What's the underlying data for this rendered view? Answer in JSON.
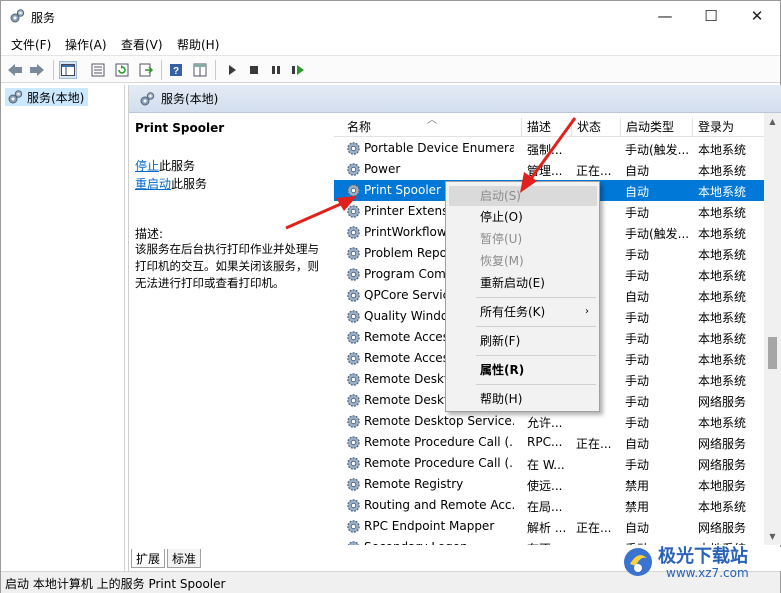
{
  "window": {
    "title": "服务",
    "minimize": "—",
    "maximize": "☐",
    "close": "✕"
  },
  "menu": [
    "文件(F)",
    "操作(A)",
    "查看(V)",
    "帮助(H)"
  ],
  "tree": {
    "root_label": "服务(本地)"
  },
  "main": {
    "header_title": "服务(本地)"
  },
  "desc_panel": {
    "service_name": "Print Spooler",
    "stop_link": "停止",
    "stop_suffix": "此服务",
    "restart_link": "重启动",
    "restart_suffix": "此服务",
    "desc_label": "描述:",
    "desc_text": "该服务在后台执行打印作业并处理与打印机的交互。如果关闭该服务，则无法进行打印或查看打印机。"
  },
  "columns": [
    "名称",
    "描述",
    "状态",
    "启动类型",
    "登录为"
  ],
  "rows": [
    {
      "name": "Portable Device Enumera...",
      "desc": "强制...",
      "status": "",
      "startup": "手动(触发...",
      "logon": "本地系统"
    },
    {
      "name": "Power",
      "desc": "管理...",
      "status": "正在...",
      "startup": "自动",
      "logon": "本地系统"
    },
    {
      "name": "Print Spooler",
      "desc": "",
      "status": "",
      "startup": "自动",
      "logon": "本地系统"
    },
    {
      "name": "Printer Extensi",
      "desc": "",
      "status": "",
      "startup": "手动",
      "logon": "本地系统"
    },
    {
      "name": "PrintWorkflow",
      "desc": "",
      "status": "",
      "startup": "手动(触发...",
      "logon": "本地系统"
    },
    {
      "name": "Problem Repo",
      "desc": "",
      "status": "",
      "startup": "手动",
      "logon": "本地系统"
    },
    {
      "name": "Program Com",
      "desc": "",
      "status": "",
      "startup": "手动",
      "logon": "本地系统"
    },
    {
      "name": "QPCore Servic",
      "desc": "",
      "status": "",
      "startup": "自动",
      "logon": "本地系统"
    },
    {
      "name": "Quality Windo",
      "desc": "",
      "status": "",
      "startup": "手动",
      "logon": "本地系统"
    },
    {
      "name": "Remote Acces",
      "desc": "",
      "status": "",
      "startup": "手动",
      "logon": "本地系统"
    },
    {
      "name": "Remote Acces",
      "desc": "",
      "status": "",
      "startup": "手动",
      "logon": "本地系统"
    },
    {
      "name": "Remote Deskt",
      "desc": "",
      "status": "",
      "startup": "手动",
      "logon": "本地系统"
    },
    {
      "name": "Remote Deskt",
      "desc": "",
      "status": "",
      "startup": "手动",
      "logon": "网络服务"
    },
    {
      "name": "Remote Desktop Service...",
      "desc": "允许...",
      "status": "",
      "startup": "手动",
      "logon": "本地系统"
    },
    {
      "name": "Remote Procedure Call (...",
      "desc": "RPC...",
      "status": "正在...",
      "startup": "自动",
      "logon": "网络服务"
    },
    {
      "name": "Remote Procedure Call (...",
      "desc": "在 W...",
      "status": "",
      "startup": "手动",
      "logon": "网络服务"
    },
    {
      "name": "Remote Registry",
      "desc": "使远...",
      "status": "",
      "startup": "禁用",
      "logon": "本地服务"
    },
    {
      "name": "Routing and Remote Acc...",
      "desc": "在局...",
      "status": "",
      "startup": "禁用",
      "logon": "本地系统"
    },
    {
      "name": "RPC Endpoint Mapper",
      "desc": "解析 ...",
      "status": "正在...",
      "startup": "自动",
      "logon": "网络服务"
    },
    {
      "name": "Secondary Logon",
      "desc": "在不...",
      "status": "",
      "startup": "手动",
      "logon": "本地系统"
    }
  ],
  "context_menu": {
    "start": "启动(S)",
    "stop": "停止(O)",
    "pause": "暂停(U)",
    "resume": "恢复(M)",
    "restart": "重新启动(E)",
    "all_tasks": "所有任务(K)",
    "refresh": "刷新(F)",
    "properties": "属性(R)",
    "help": "帮助(H)"
  },
  "tabs": [
    "扩展",
    "标准"
  ],
  "status_text": "启动 本地计算机 上的服务 Print Spooler",
  "watermark": {
    "brand": "极光下载站",
    "url": "www.xz7.com"
  },
  "colors": {
    "selection": "#0078d7",
    "link": "#0066cc",
    "arrow": "#e0211c",
    "header_bg": "#d9e3f1"
  }
}
